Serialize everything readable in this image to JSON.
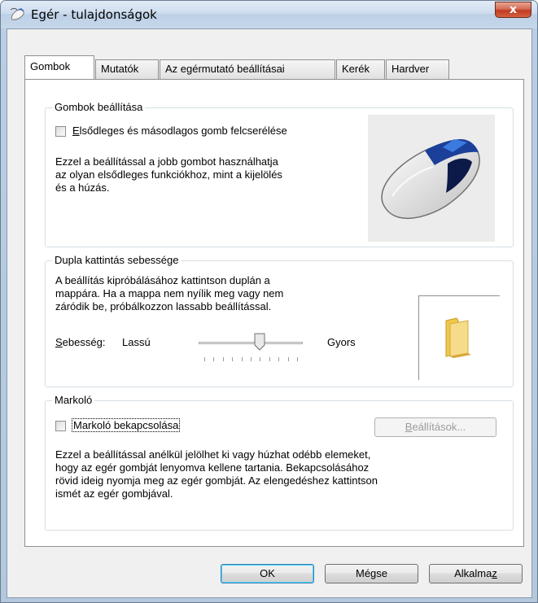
{
  "window": {
    "title": "Egér - tulajdonságok",
    "close_label": "x"
  },
  "tabs": [
    {
      "label": "Gombok",
      "active": true
    },
    {
      "label": "Mutatók",
      "active": false
    },
    {
      "label": "Az egérmutató beállításai",
      "active": false
    },
    {
      "label": "Kerék",
      "active": false
    },
    {
      "label": "Hardver",
      "active": false
    }
  ],
  "buttons_group": {
    "title": "Gombok beállítása",
    "swap_checkbox": {
      "accel": "E",
      "rest": "lsődleges és másodlagos gomb felcserélése",
      "checked": false
    },
    "description": [
      "Ezzel a beállítással a jobb gombot használhatja",
      "az olyan elsődleges funkciókhoz, mint a kijelölés",
      "és a húzás."
    ]
  },
  "double_click": {
    "title": "Dupla kattintás sebessége",
    "description": [
      "A beállítás kipróbálásához kattintson duplán a",
      "mappára. Ha a mappa nem nyílik meg vagy nem",
      "záródik be, próbálkozzon lassabb beállítással."
    ],
    "speed_label_accel": "S",
    "speed_label_rest": "ebesség:",
    "slow_label": "Lassú",
    "fast_label": "Gyors",
    "slider_value": 0.6
  },
  "clicklock": {
    "title": "Markoló",
    "checkbox_label": "Markoló bekapcsolása",
    "checked": false,
    "settings_accel": "B",
    "settings_rest": "eállítások...",
    "description": [
      "Ezzel a beállítással anélkül jelölhet ki vagy húzhat odébb elemeket,",
      "hogy az egér gombját lenyomva kellene tartania.  Bekapcsolásához",
      "rövid ideig nyomja meg az egér gombját.  Az elengedéshez kattintson",
      "ismét az egér gombjával."
    ]
  },
  "footer": {
    "ok": "OK",
    "cancel": "Mégse",
    "apply_rest": "Alkalma",
    "apply_accel": "z"
  }
}
